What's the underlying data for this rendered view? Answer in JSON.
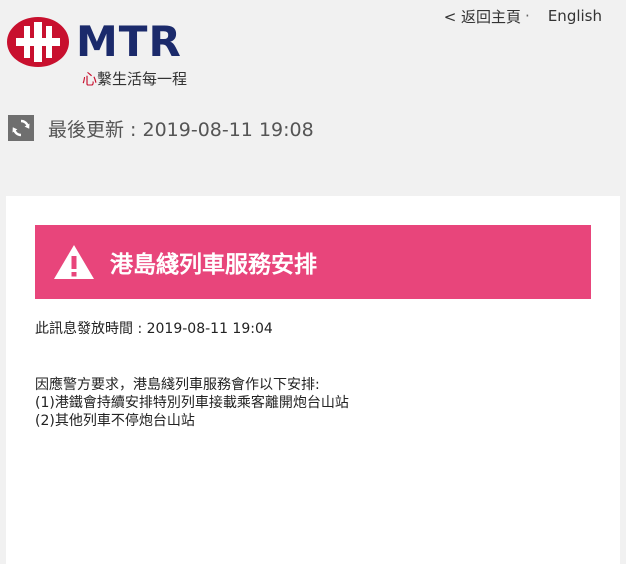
{
  "header": {
    "logo_word": "MTR",
    "tagline_accent": "心",
    "tagline_rest": "繫生活每一程",
    "nav": {
      "back_label": "< 返回主頁",
      "separator": "·",
      "language_label": "English"
    },
    "last_updated_label": "最後更新 : 2019-08-11 19:08"
  },
  "notice": {
    "title": "港島綫列車服務安排",
    "issued_at": "此訊息發放時間 : 2019-08-11 19:04",
    "body_lines": [
      "因應警方要求，港島綫列車服務會作以下安排:",
      "(1)港鐵會持續安排特別列車接載乘客離開炮台山站",
      "(2)其他列車不停炮台山站"
    ]
  },
  "icons": {
    "logo": "mtr-logo-icon",
    "refresh": "refresh-icon",
    "warning": "warning-icon"
  },
  "colors": {
    "brand_red": "#c8102e",
    "brand_navy": "#1b2a6b",
    "alert_pink": "#e8457b",
    "refresh_gray": "#6f6f6f"
  }
}
